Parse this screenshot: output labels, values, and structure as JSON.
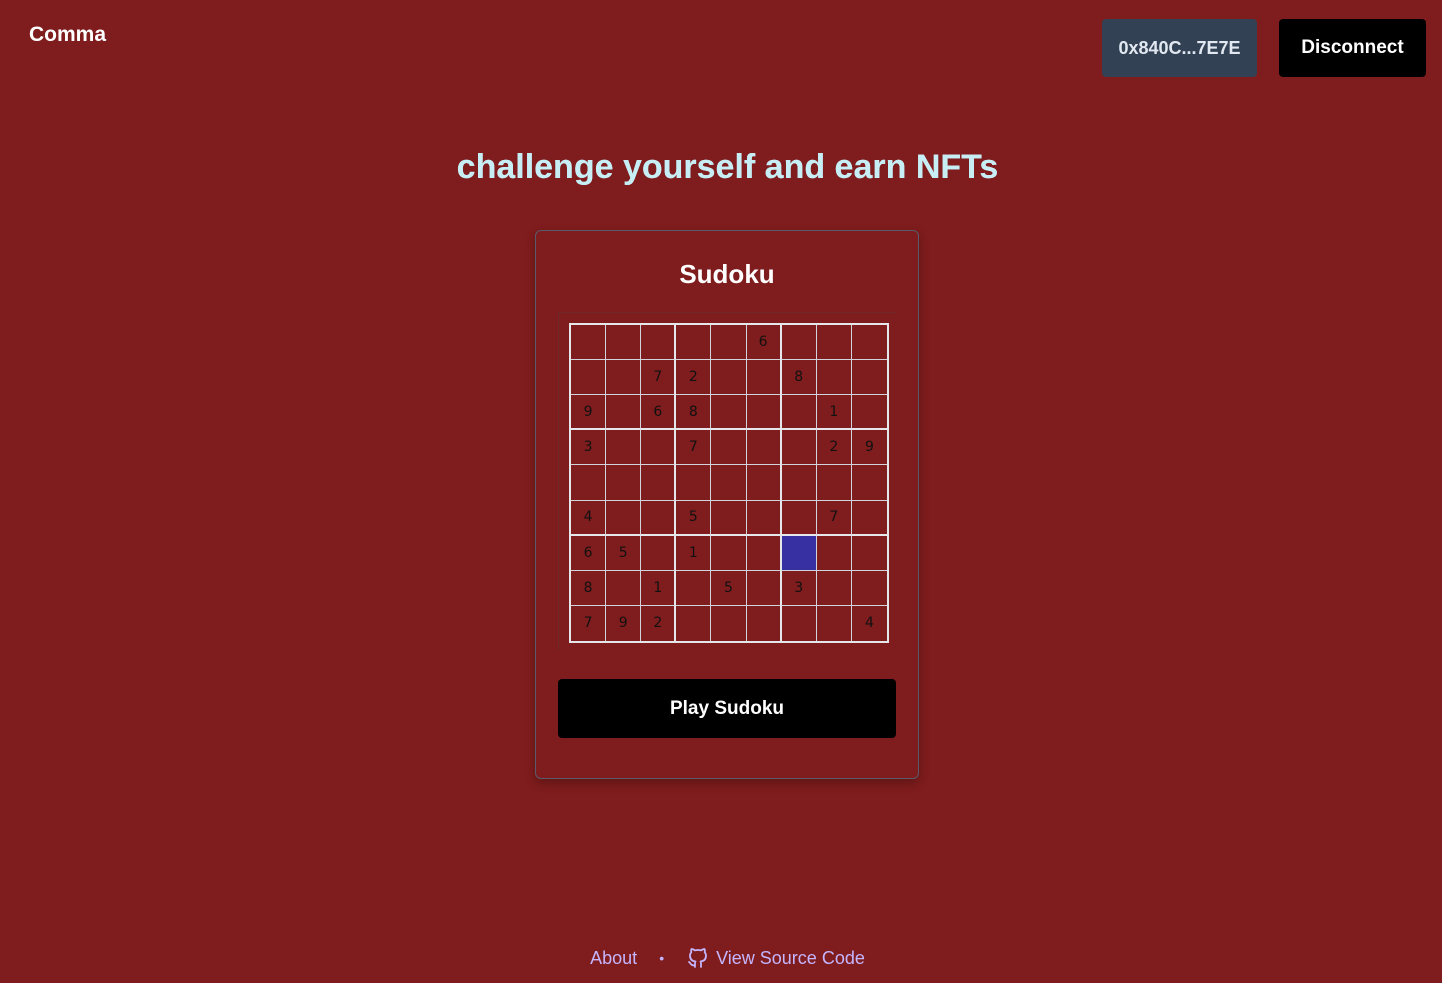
{
  "header": {
    "brand": "Comma",
    "wallet_address": "0x840C...7E7E",
    "disconnect_label": "Disconnect"
  },
  "hero": {
    "headline": "challenge yourself and earn NFTs"
  },
  "card": {
    "title": "Sudoku",
    "play_label": "Play Sudoku",
    "board": [
      [
        "",
        "",
        "",
        "",
        "",
        "6",
        "",
        "",
        ""
      ],
      [
        "",
        "",
        "7",
        "2",
        "",
        "",
        "8",
        "",
        ""
      ],
      [
        "9",
        "",
        "6",
        "8",
        "",
        "",
        "",
        "1",
        ""
      ],
      [
        "3",
        "",
        "",
        "7",
        "",
        "",
        "",
        "2",
        "9"
      ],
      [
        "",
        "",
        "",
        "",
        "",
        "",
        "",
        "",
        ""
      ],
      [
        "4",
        "",
        "",
        "5",
        "",
        "",
        "",
        "7",
        ""
      ],
      [
        "6",
        "5",
        "",
        "1",
        "",
        "",
        "",
        "",
        ""
      ],
      [
        "8",
        "",
        "1",
        "",
        "5",
        "",
        "3",
        "",
        ""
      ],
      [
        "7",
        "9",
        "2",
        "",
        "",
        "",
        "",
        "",
        "4"
      ]
    ],
    "selected_cell": {
      "row": 6,
      "col": 6
    },
    "selected_color": "#3730a3"
  },
  "footer": {
    "about_label": "About",
    "separator": "•",
    "source_label": "View Source Code",
    "source_icon": "github-icon"
  },
  "colors": {
    "background": "#7f1c1d",
    "wallet_bg": "#334155",
    "button_bg": "#000000",
    "link": "#c4b5fd"
  }
}
